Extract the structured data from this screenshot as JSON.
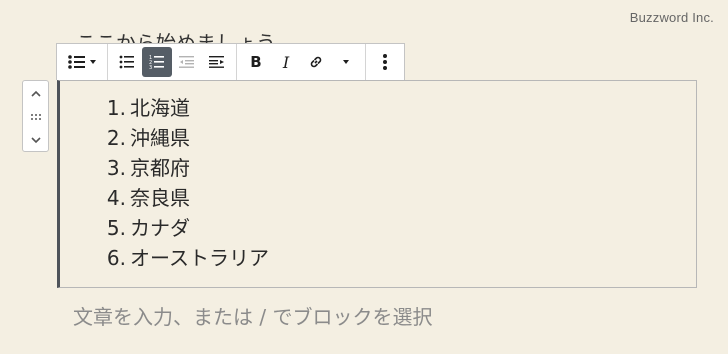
{
  "watermark": "Buzzword Inc.",
  "partial_text": "ここから始めましょう",
  "toolbar": {
    "list_style_dropdown": "list-style-icon",
    "unordered": "unordered-list-icon",
    "ordered": "ordered-list-icon",
    "outdent": "outdent-icon",
    "indent": "indent-icon",
    "bold": "B",
    "italic": "I",
    "link": "link-icon",
    "more_dropdown": "chevron-down-icon",
    "options": "more-options-icon"
  },
  "list": {
    "items": [
      {
        "num": "1.",
        "text": "北海道"
      },
      {
        "num": "2.",
        "text": "沖縄県"
      },
      {
        "num": "3.",
        "text": "京都府"
      },
      {
        "num": "4.",
        "text": "奈良県"
      },
      {
        "num": "5.",
        "text": "カナダ"
      },
      {
        "num": "6.",
        "text": "オーストラリア"
      }
    ]
  },
  "placeholder": "文章を入力、または / でブロックを選択",
  "colors": {
    "background": "#f4efe2",
    "active_button": "#555d66",
    "block_border_left": "#4e535a"
  }
}
